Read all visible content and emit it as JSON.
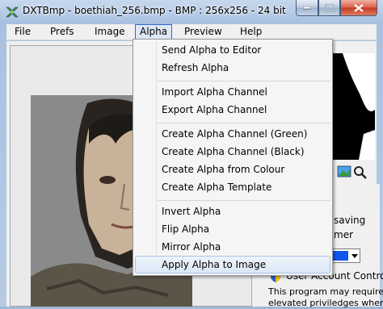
{
  "window": {
    "title": "DXTBmp - boethiah_256.bmp - BMP : 256x256 - 24 bit"
  },
  "menubar": {
    "items": [
      "File",
      "Prefs",
      "Image",
      "Alpha",
      "Preview",
      "Help"
    ]
  },
  "alpha_menu": {
    "groups": [
      [
        "Send Alpha to Editor",
        "Refresh Alpha"
      ],
      [
        "Import Alpha Channel",
        "Export Alpha Channel"
      ],
      [
        "Create Alpha Channel (Green)",
        "Create Alpha Channel (Black)",
        "Create Alpha from Colour",
        "Create Alpha Template"
      ],
      [
        "Invert Alpha",
        "Flip Alpha",
        "Mirror Alpha",
        "Apply Alpha to Image"
      ]
    ],
    "highlighted": "Apply Alpha to Image"
  },
  "side_panel": {
    "saving_text": "saving",
    "mer_text": "mer",
    "color_value": "#1155ee"
  },
  "uac": {
    "title": "User Account Control",
    "line1": "This program may require",
    "line2": "elevated priviledges when"
  },
  "colors": {
    "menu_highlight": "#dde8f7",
    "close_button": "#c23a22"
  }
}
